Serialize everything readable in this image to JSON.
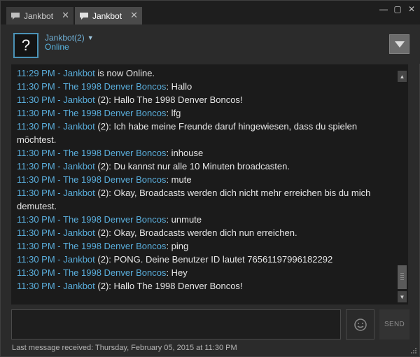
{
  "tabs": [
    {
      "label": "Jankbot",
      "active": false
    },
    {
      "label": "Jankbot",
      "active": true
    }
  ],
  "window_controls": {
    "close": "✕",
    "maximize": "▢",
    "minimize": "—"
  },
  "friend": {
    "avatar_glyph": "?",
    "name": "Jankbot(2)",
    "status": "Online"
  },
  "messages": [
    {
      "time": "11:29 PM - ",
      "sender": "Jankbot",
      "sender_tag": "",
      "text": " is now Online."
    },
    {
      "time": "11:30 PM - ",
      "sender": "The 1998 Denver Boncos",
      "sender_tag": "",
      "text": ": Hallo"
    },
    {
      "time": "11:30 PM - ",
      "sender": "Jankbot",
      "sender_tag": " (2)",
      "text": ": Hallo The 1998 Denver Boncos!"
    },
    {
      "time": "11:30 PM - ",
      "sender": "The 1998 Denver Boncos",
      "sender_tag": "",
      "text": ": lfg"
    },
    {
      "time": "11:30 PM - ",
      "sender": "Jankbot",
      "sender_tag": " (2)",
      "text": ": Ich habe meine Freunde daruf hingewiesen, dass du spielen möchtest."
    },
    {
      "time": "11:30 PM - ",
      "sender": "The 1998 Denver Boncos",
      "sender_tag": "",
      "text": ": inhouse"
    },
    {
      "time": "11:30 PM - ",
      "sender": "Jankbot",
      "sender_tag": " (2)",
      "text": ": Du kannst nur alle 10 Minuten broadcasten."
    },
    {
      "time": "11:30 PM - ",
      "sender": "The 1998 Denver Boncos",
      "sender_tag": "",
      "text": ": mute"
    },
    {
      "time": "11:30 PM - ",
      "sender": "Jankbot",
      "sender_tag": " (2)",
      "text": ": Okay, Broadcasts werden dich nicht mehr erreichen bis du mich demutest."
    },
    {
      "time": "11:30 PM - ",
      "sender": "The 1998 Denver Boncos",
      "sender_tag": "",
      "text": ": unmute"
    },
    {
      "time": "11:30 PM - ",
      "sender": "Jankbot",
      "sender_tag": " (2)",
      "text": ": Okay, Broadcasts werden dich nun erreichen."
    },
    {
      "time": "11:30 PM - ",
      "sender": "The 1998 Denver Boncos",
      "sender_tag": "",
      "text": ": ping"
    },
    {
      "time": "11:30 PM - ",
      "sender": "Jankbot",
      "sender_tag": " (2)",
      "text": ": PONG. Deine Benutzer ID lautet 76561197996182292"
    },
    {
      "time": "11:30 PM - ",
      "sender": "The 1998 Denver Boncos",
      "sender_tag": "",
      "text": ": Hey"
    },
    {
      "time": "11:30 PM - ",
      "sender": "Jankbot",
      "sender_tag": " (2)",
      "text": ": Hallo The 1998 Denver Boncos!"
    }
  ],
  "composer": {
    "value": "",
    "send_label": "SEND"
  },
  "footer": {
    "last_message": "Last message received: Thursday, February 05, 2015 at 11:30 PM"
  },
  "colors": {
    "accent": "#5aaedc",
    "background": "#2b2b2b",
    "chat_bg": "#1b1b1b"
  }
}
